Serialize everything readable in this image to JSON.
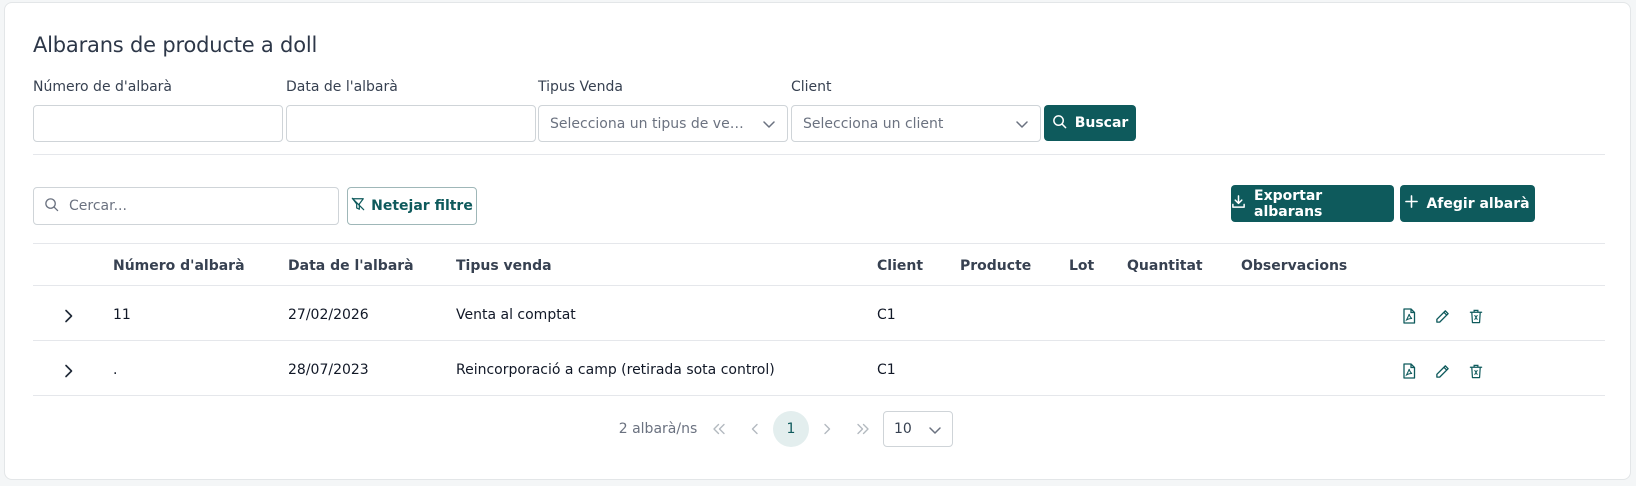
{
  "page": {
    "title": "Albarans de producte a doll"
  },
  "filters": {
    "numero_label": "Número de d'albarà",
    "data_label": "Data de l'albarà",
    "tipus_label": "Tipus Venda",
    "tipus_placeholder": "Selecciona un tipus de venda",
    "client_label": "Client",
    "client_placeholder": "Selecciona un client",
    "buscar_label": "Buscar"
  },
  "toolbar": {
    "search_placeholder": "Cercar...",
    "clear_filter_label": "Netejar filtre",
    "export_label": "Exportar albarans",
    "add_label": "Afegir albarà"
  },
  "table": {
    "columns": [
      "Número d'albarà",
      "Data de l'albarà",
      "Tipus venda",
      "Client",
      "Producte",
      "Lot",
      "Quantitat",
      "Observacions"
    ],
    "rows": [
      {
        "numero": "11",
        "data": "27/02/2026",
        "tipus": "Venta al comptat",
        "client": "C1",
        "producte": "",
        "lot": "",
        "quantitat": "",
        "observacions": ""
      },
      {
        "numero": ".",
        "data": "28/07/2023",
        "tipus": "Reincorporació a camp (retirada sota control)",
        "client": "C1",
        "producte": "",
        "lot": "",
        "quantitat": "",
        "observacions": ""
      }
    ]
  },
  "pagination": {
    "total_label": "2 albarà/ns",
    "current_page": "1",
    "page_size": "10"
  },
  "colors": {
    "primary": "#0e5a5c",
    "border": "#cfd4d8",
    "active_page_bg": "#e3eeee"
  },
  "icons": [
    "chevron-down-icon",
    "search-icon",
    "filter-off-icon",
    "download-icon",
    "plus-icon",
    "chevron-right-icon",
    "file-pdf-icon",
    "pencil-icon",
    "trash-icon",
    "chevrons-left-icon",
    "chevron-left-icon",
    "chevrons-right-icon"
  ]
}
